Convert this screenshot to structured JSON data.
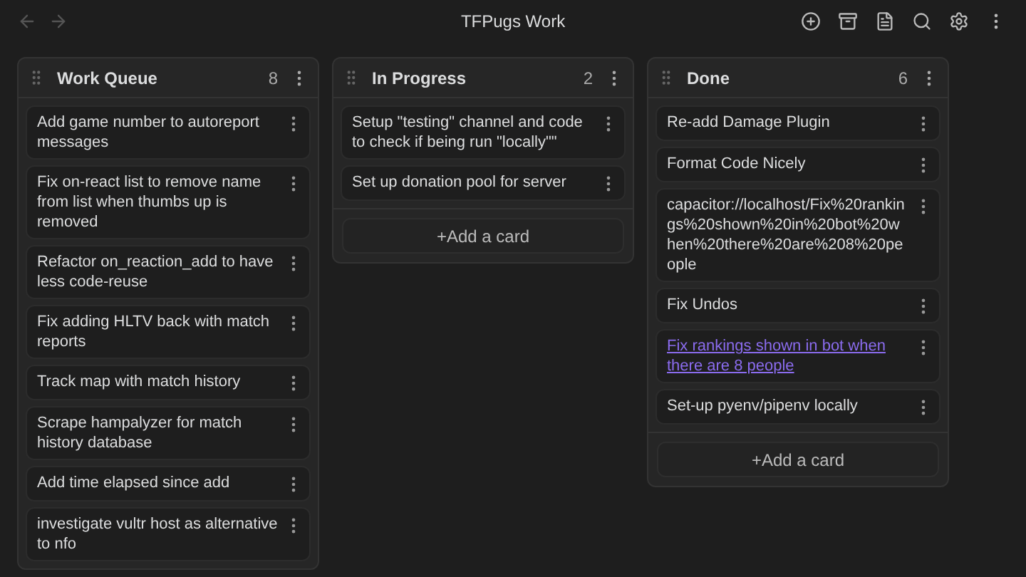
{
  "window": {
    "title": "TFPugs Work"
  },
  "nav": [
    {
      "kind": "back",
      "disabled": true
    },
    {
      "kind": "forward",
      "disabled": true
    }
  ],
  "toolbar": [
    {
      "kind": "add"
    },
    {
      "kind": "archive"
    },
    {
      "kind": "document"
    },
    {
      "kind": "search"
    },
    {
      "kind": "settings"
    },
    {
      "kind": "more"
    }
  ],
  "lanes": [
    {
      "title": "Work Queue",
      "count": "8",
      "cards": [
        {
          "kind": "text",
          "text": "Add game number to autoreport messages"
        },
        {
          "kind": "text",
          "text": "Fix on-react list to remove name from list when thumbs up is removed"
        },
        {
          "kind": "text",
          "text": "Refactor on_reaction_add to have less code-reuse"
        },
        {
          "kind": "text",
          "text": "Fix adding HLTV back with match reports"
        },
        {
          "kind": "text",
          "text": "Track map with match history"
        },
        {
          "kind": "text",
          "text": "Scrape hampalyzer for match history database"
        },
        {
          "kind": "text",
          "text": "Add time elapsed since add"
        },
        {
          "kind": "text",
          "text": "investigate vultr host as alternative to nfo"
        }
      ]
    },
    {
      "title": "In Progress",
      "count": "2",
      "add_card": "+Add a card",
      "cards": [
        {
          "kind": "text",
          "text": "Setup \"testing\" channel and code to check if being run \"locally\"\""
        },
        {
          "kind": "text",
          "text": "Set up donation pool for server"
        }
      ]
    },
    {
      "title": "Done",
      "count": "6",
      "add_card": "+Add a card",
      "cards": [
        {
          "kind": "text",
          "text": "Re-add Damage Plugin"
        },
        {
          "kind": "text",
          "text": "Format Code Nicely"
        },
        {
          "kind": "url",
          "text": "capacitor://localhost/Fix%20rankings%20shown%20in%20bot%20when%20there%20are%208%20people"
        },
        {
          "kind": "text",
          "text": "Fix Undos"
        },
        {
          "kind": "link",
          "text": "Fix rankings shown in bot when there are 8 people"
        },
        {
          "kind": "text",
          "text": "Set-up pyenv/pipenv locally"
        }
      ]
    }
  ]
}
